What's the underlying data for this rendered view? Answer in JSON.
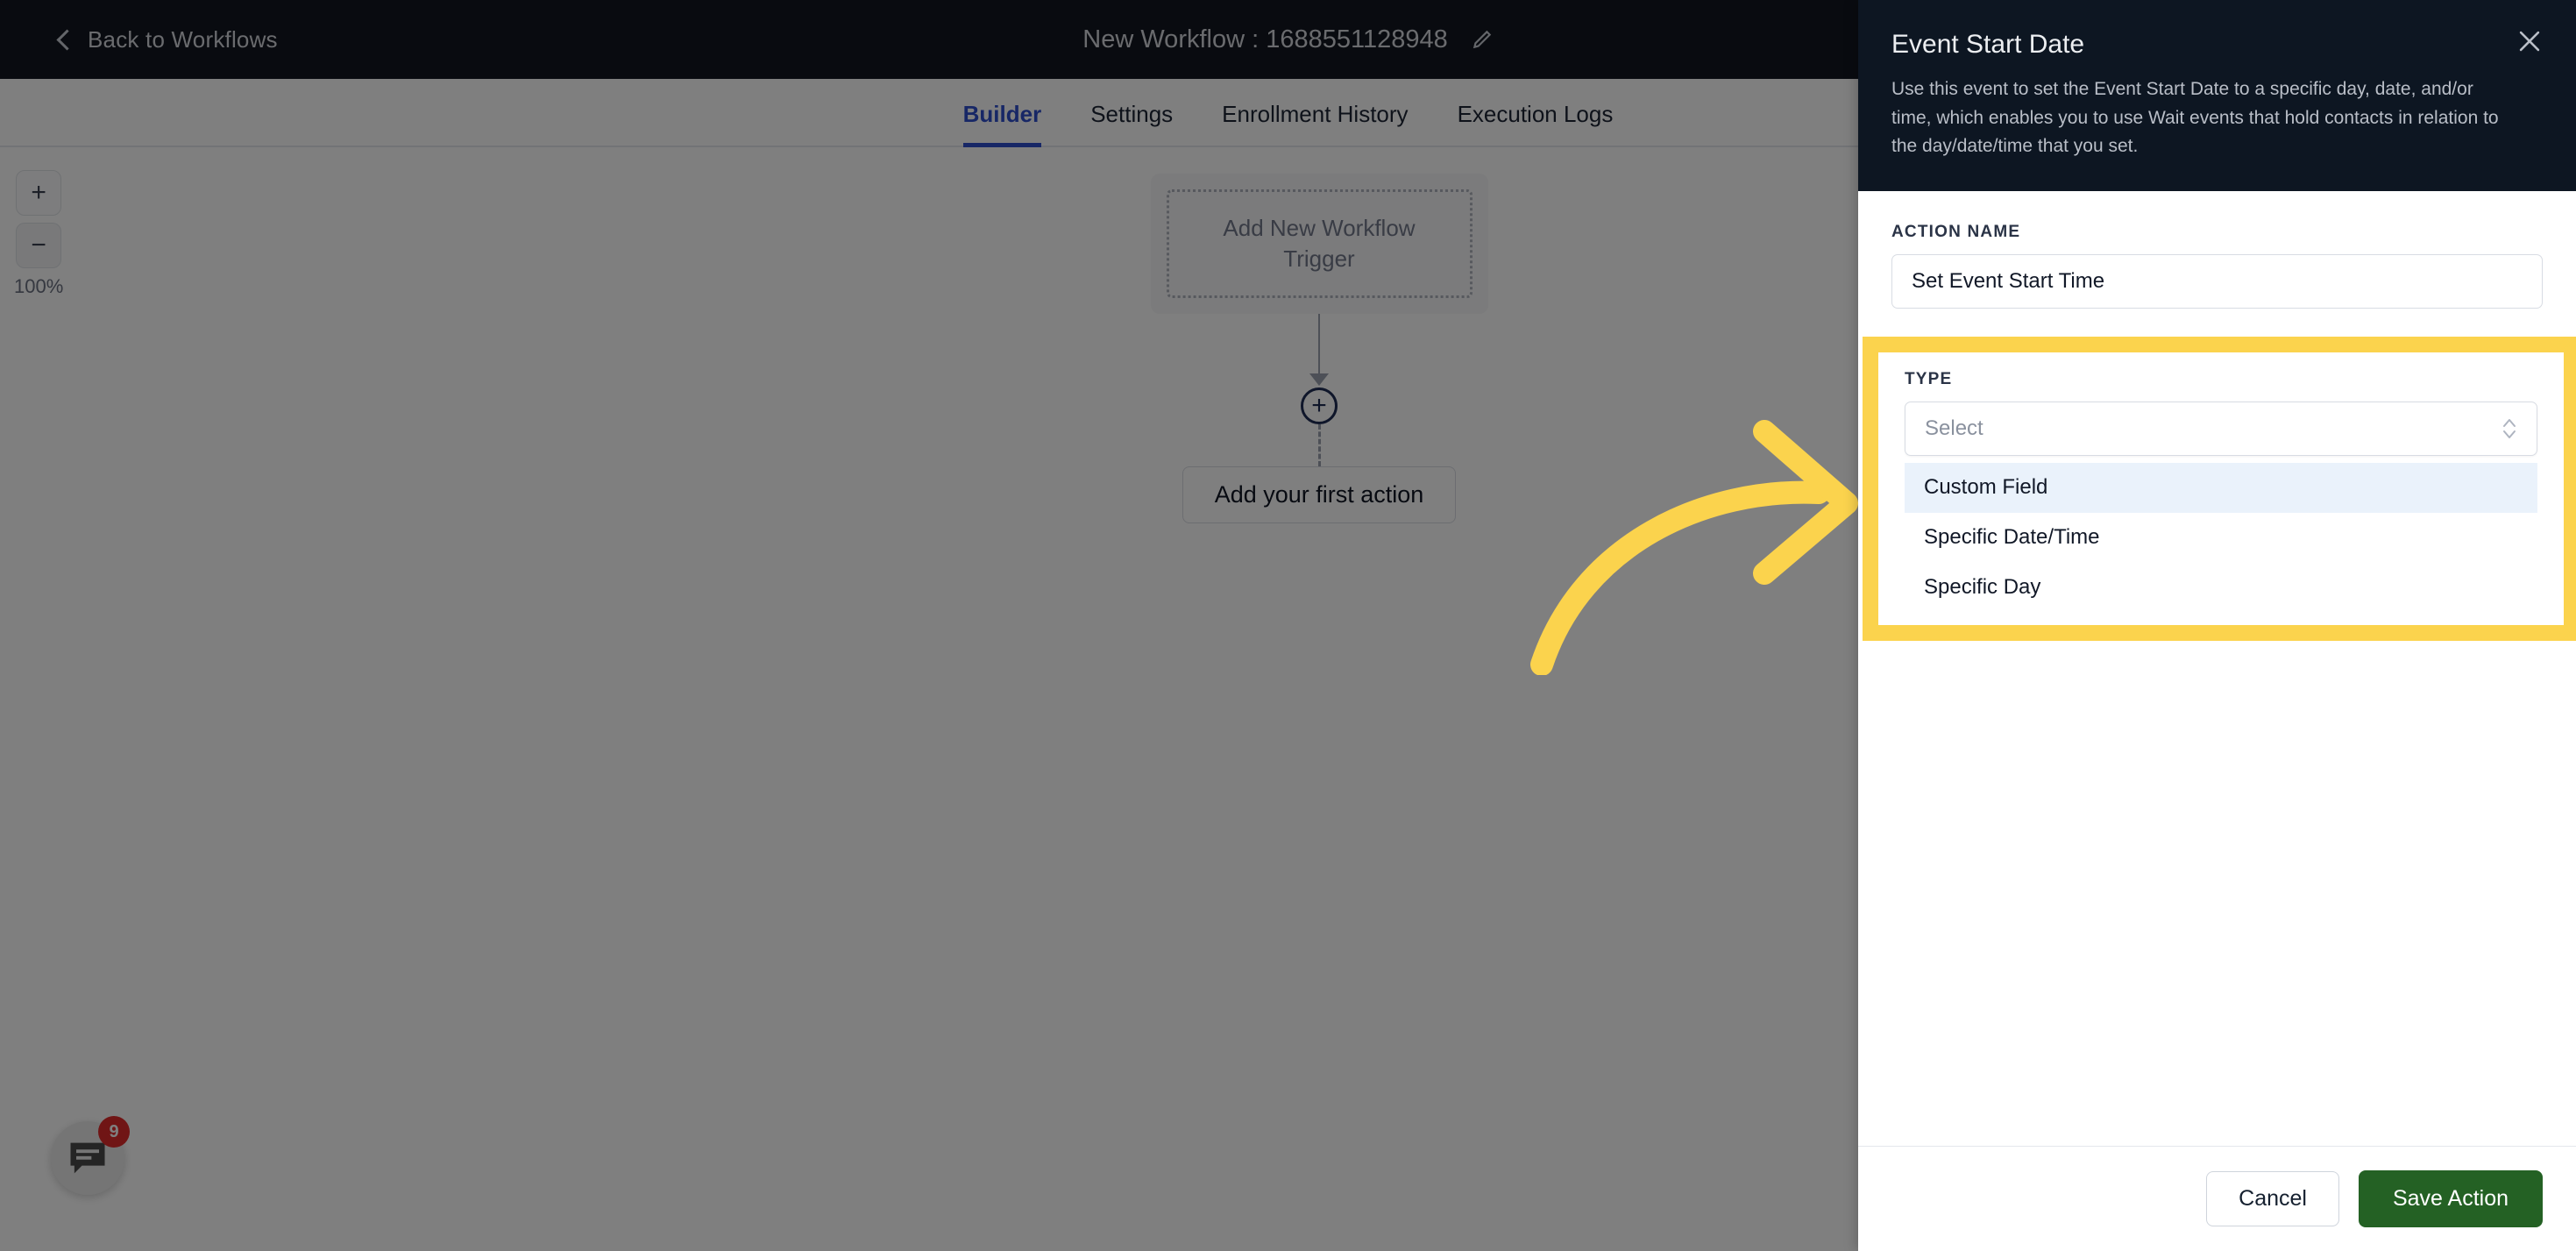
{
  "topbar": {
    "back_label": "Back to Workflows",
    "back_icon": "chevron-left-icon",
    "workflow_title": "New Workflow : 1688551128948",
    "edit_icon": "pencil-icon"
  },
  "tabs": [
    {
      "label": "Builder",
      "active": true
    },
    {
      "label": "Settings",
      "active": false
    },
    {
      "label": "Enrollment History",
      "active": false
    },
    {
      "label": "Execution Logs",
      "active": false
    }
  ],
  "canvas": {
    "zoom": {
      "zoom_in_label": "+",
      "zoom_out_label": "−",
      "level_label": "100%"
    },
    "trigger_card_label": "Add New Workflow Trigger",
    "add_node_icon": "plus-circle-icon",
    "first_action_label": "Add your first action"
  },
  "chat_widget": {
    "icon": "chat-bubble-icon",
    "badge_count": "9",
    "badge_color": "#e02a2a"
  },
  "panel": {
    "title": "Event Start Date",
    "close_icon": "close-icon",
    "description": "Use this event to set the Event Start Date to a specific day, date, and/or time, which enables you to use Wait events that hold contacts in relation to the day/date/time that you set.",
    "action_name": {
      "label": "ACTION NAME",
      "value": "Set Event Start Time",
      "placeholder": "Action name"
    },
    "type": {
      "label": "TYPE",
      "select_placeholder": "Select",
      "select_value": "",
      "dropdown_icon": "chevron-up-down-icon",
      "options": [
        {
          "label": "Custom Field",
          "highlighted": true
        },
        {
          "label": "Specific Date/Time",
          "highlighted": false
        },
        {
          "label": "Specific Day",
          "highlighted": false
        }
      ]
    },
    "footer": {
      "cancel_label": "Cancel",
      "save_label": "Save Action"
    }
  },
  "annotation": {
    "arrow_icon": "curved-arrow-right-icon",
    "highlight_color": "#fbd34d"
  }
}
